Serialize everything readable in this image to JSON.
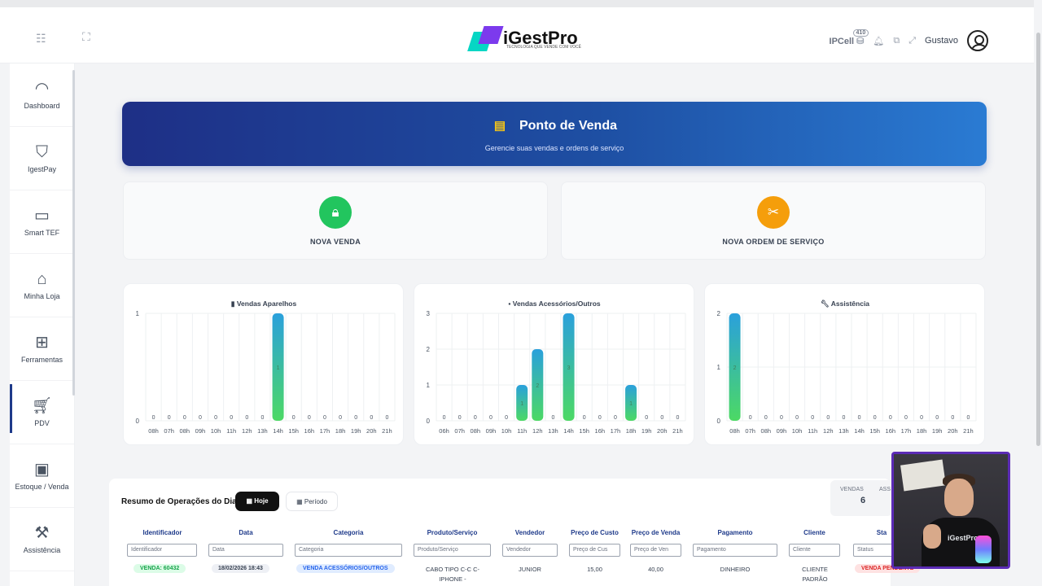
{
  "header": {
    "logo_text": "iGestPro",
    "logo_tagline": "TECNOLOGIA QUE VENDE COM VOCÊ",
    "store": "IPCell",
    "badge": "410",
    "user": "Gustavo"
  },
  "sidebar": {
    "items": [
      {
        "label": "Dashboard"
      },
      {
        "label": "IgestPay"
      },
      {
        "label": "Smart TEF"
      },
      {
        "label": "Minha Loja"
      },
      {
        "label": "Ferramentas"
      },
      {
        "label": "PDV"
      },
      {
        "label": "Estoque / Venda"
      },
      {
        "label": "Assistência"
      }
    ]
  },
  "banner": {
    "title": "Ponto de Venda",
    "subtitle": "Gerencie suas vendas e ordens de serviço"
  },
  "actions": {
    "nova_venda": "NOVA VENDA",
    "nova_os": "NOVA ORDEM DE SERVIÇO"
  },
  "chart_data": [
    {
      "type": "bar",
      "title": "Vendas Aparelhos",
      "categories": [
        "08h",
        "07h",
        "08h",
        "09h",
        "10h",
        "11h",
        "12h",
        "13h",
        "14h",
        "15h",
        "16h",
        "17h",
        "18h",
        "19h",
        "20h",
        "21h"
      ],
      "values": [
        0,
        0,
        0,
        0,
        0,
        0,
        0,
        0,
        1,
        0,
        0,
        0,
        0,
        0,
        0,
        0
      ],
      "ylim": [
        0,
        1
      ],
      "yticks": [
        "0",
        "1"
      ],
      "grid": true
    },
    {
      "type": "bar",
      "title": "Vendas Acessórios/Outros",
      "categories": [
        "06h",
        "07h",
        "08h",
        "09h",
        "10h",
        "11h",
        "12h",
        "13h",
        "14h",
        "15h",
        "16h",
        "17h",
        "18h",
        "19h",
        "20h",
        "21h"
      ],
      "values": [
        0,
        0,
        0,
        0,
        0,
        1,
        2,
        0,
        3,
        0,
        0,
        0,
        1,
        0,
        0,
        0
      ],
      "ylim": [
        0,
        3
      ],
      "yticks": [
        "0",
        "1",
        "2",
        "3"
      ],
      "grid": true
    },
    {
      "type": "bar",
      "title": "Assistência",
      "categories": [
        "08h",
        "07h",
        "08h",
        "09h",
        "10h",
        "11h",
        "12h",
        "13h",
        "14h",
        "15h",
        "16h",
        "17h",
        "18h",
        "19h",
        "20h",
        "21h"
      ],
      "values": [
        2,
        0,
        0,
        0,
        0,
        0,
        0,
        0,
        0,
        0,
        0,
        0,
        0,
        0,
        0,
        0
      ],
      "ylim": [
        0,
        2
      ],
      "yticks": [
        "0",
        "1",
        "2"
      ],
      "grid": true
    }
  ],
  "summary": {
    "title": "Resumo de Operações do Dia",
    "btn_hoje": "Hoje",
    "btn_periodo": "Período",
    "kpi_label": "VENDAS",
    "kpi_value": "6",
    "kpi2_label": "ASS",
    "columns": [
      "Identificador",
      "Data",
      "Categoria",
      "Produto/Serviço",
      "Vendedor",
      "Preço de Custo",
      "Preço de Venda",
      "Pagamento",
      "Cliente",
      "Sta"
    ],
    "filters": [
      "Identificador",
      "Data",
      "Categoria",
      "Produto/Serviço",
      "Vendedor",
      "Preço de Cus",
      "Preço de Ven",
      "Pagamento",
      "Cliente",
      "Status"
    ],
    "row": {
      "id": "VENDA: 60432",
      "date": "18/02/2026 18:43",
      "category": "VENDA ACESSÓRIOS/OUTROS",
      "product": "CABO TIPO C-C C-IPHONE -",
      "seller": "JUNIOR",
      "cost": "15,00",
      "price": "40,00",
      "payment": "DINHEIRO",
      "client": "CLIENTE PADRÃO",
      "status": "VENDA PENDENTE"
    }
  },
  "colors": {
    "accent": "#1e3a8a",
    "green": "#22c55e",
    "orange": "#f59e0b",
    "bar_top": "#2aa0dc",
    "bar_bottom": "#4cd964"
  }
}
